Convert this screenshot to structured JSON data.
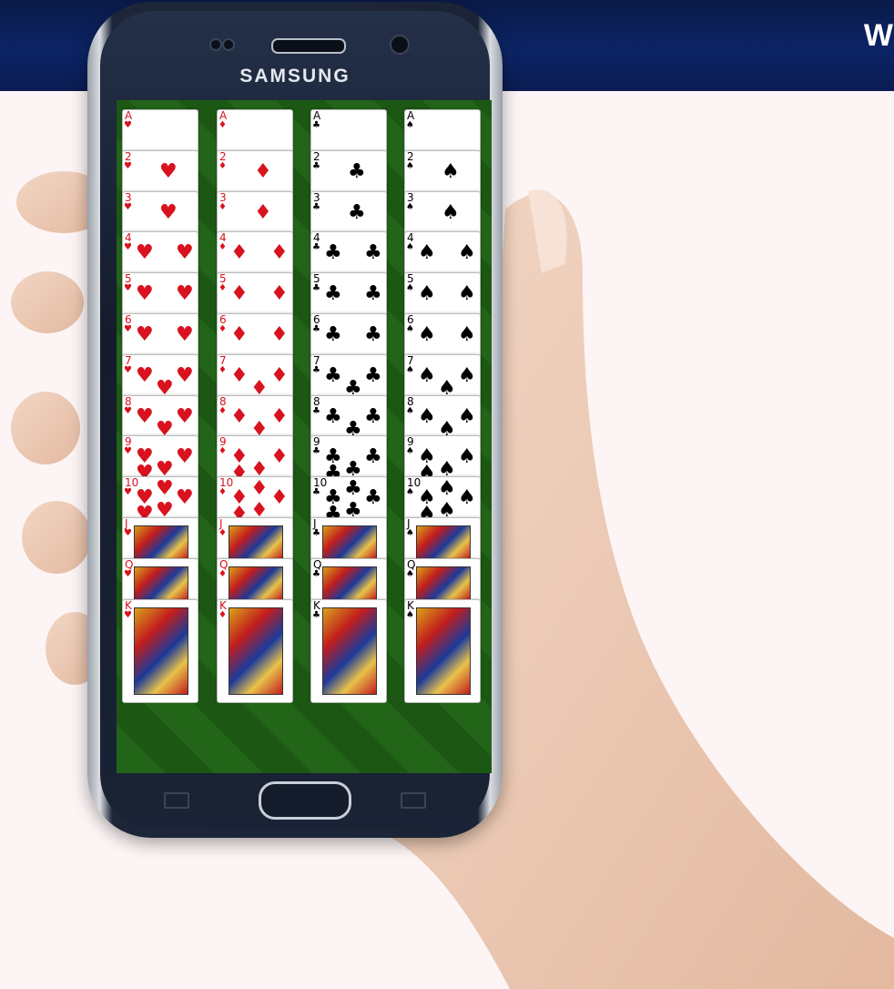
{
  "header": {
    "text": "W"
  },
  "phone": {
    "brand": "SAMSUNG"
  },
  "game": {
    "felt_color": "#1d5a12",
    "columns": [
      {
        "suit": "hearts",
        "symbol": "♥",
        "color": "red"
      },
      {
        "suit": "diamonds",
        "symbol": "♦",
        "color": "red"
      },
      {
        "suit": "clubs",
        "symbol": "♣",
        "color": "black"
      },
      {
        "suit": "spades",
        "symbol": "♠",
        "color": "black"
      }
    ],
    "ranks": [
      "A",
      "2",
      "3",
      "4",
      "5",
      "6",
      "7",
      "8",
      "9",
      "10",
      "J",
      "Q",
      "K"
    ]
  }
}
